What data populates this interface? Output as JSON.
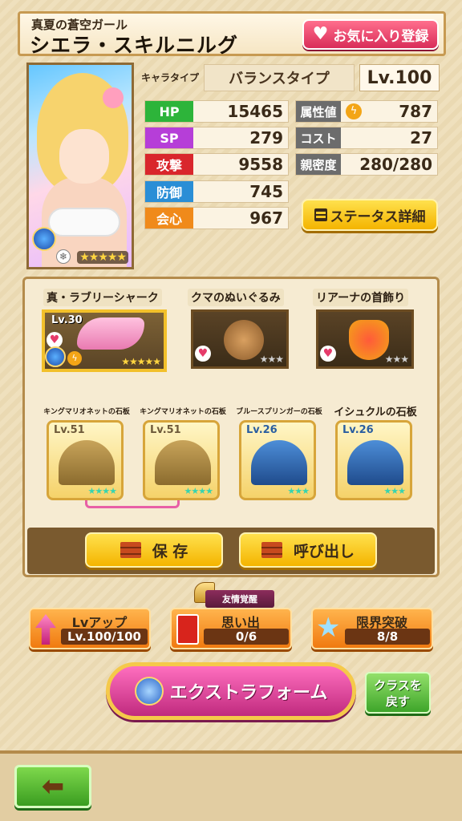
{
  "header": {
    "subtitle": "真夏の蒼空ガール",
    "name": "シエラ・スキルニルグ",
    "favorite_label": "お気に入り登録"
  },
  "portrait": {
    "stars": "★★★★★"
  },
  "char_type": {
    "label": "キャラタイプ",
    "value": "バランスタイプ",
    "level": "Lv.100"
  },
  "stats_left": [
    {
      "label": "HP",
      "value": "15465",
      "color": "#2db43a"
    },
    {
      "label": "SP",
      "value": "279",
      "color": "#b63ed8"
    },
    {
      "label": "攻撃",
      "value": "9558",
      "color": "#d9262c"
    },
    {
      "label": "防御",
      "value": "745",
      "color": "#2a8ed6"
    },
    {
      "label": "会心",
      "value": "967",
      "color": "#f08a1a"
    }
  ],
  "stats_right": [
    {
      "label": "属性値",
      "value": "787",
      "icon": "lightning-icon"
    },
    {
      "label": "コスト",
      "value": "27"
    },
    {
      "label": "親密度",
      "value": "280/280"
    }
  ],
  "status_detail_label": "ステータス詳細",
  "equipment": [
    {
      "name": "真・ラブリーシャーク",
      "level": "Lv.30",
      "stars": "★★★★★",
      "rarity": "gold"
    },
    {
      "name": "クマのぬいぐるみ",
      "stars": "★★★"
    },
    {
      "name": "リアーナの首飾り",
      "stars": "★★★"
    }
  ],
  "stones": [
    {
      "name": "キングマリオネットの石板",
      "level": "Lv.51",
      "stars": "★★★★",
      "style": "gold"
    },
    {
      "name": "キングマリオネットの石板",
      "level": "Lv.51",
      "stars": "★★★★",
      "style": "gold"
    },
    {
      "name": "ブルースプリンガーの石板",
      "level": "Lv.26",
      "stars": "★★★",
      "style": "blue"
    },
    {
      "name": "イシュクルの石板",
      "level": "Lv.26",
      "stars": "★★★",
      "style": "blue"
    }
  ],
  "actions": {
    "save": "保 存",
    "recall": "呼び出し"
  },
  "growth": {
    "level_up": {
      "title": "Lvアップ",
      "value": "Lv.100/100"
    },
    "badge": "友情覚醒",
    "memory": {
      "title": "思い出",
      "value": "0/6"
    },
    "limit_break": {
      "title": "限界突破",
      "value": "8/8"
    }
  },
  "extra_form": "エクストラフォーム",
  "class_back": [
    "クラスを",
    "戻す"
  ],
  "back_label": "⬅"
}
